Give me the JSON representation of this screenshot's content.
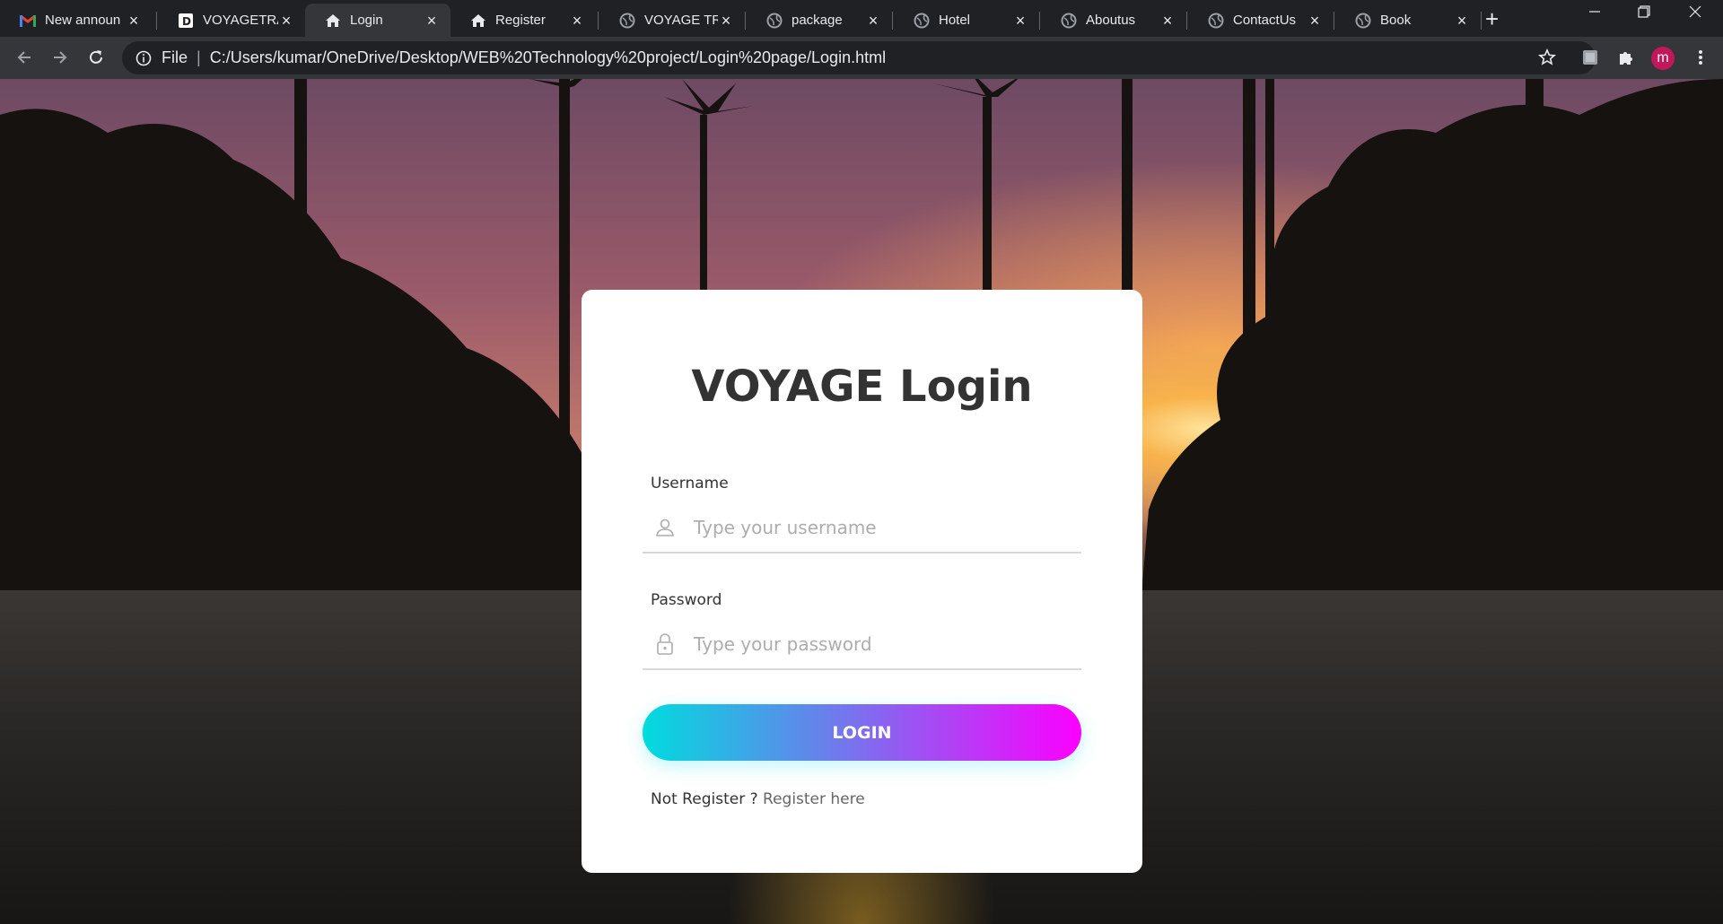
{
  "browser": {
    "tabs": [
      {
        "label": "New announ",
        "icon": "gmail-icon"
      },
      {
        "label": "VOYAGETRA",
        "icon": "page-d-icon"
      },
      {
        "label": "Login",
        "icon": "home-icon",
        "active": true
      },
      {
        "label": "Register",
        "icon": "home-icon"
      },
      {
        "label": "VOYAGE TRA",
        "icon": "globe-icon"
      },
      {
        "label": "package",
        "icon": "globe-icon"
      },
      {
        "label": "Hotel",
        "icon": "globe-icon"
      },
      {
        "label": "Aboutus",
        "icon": "globe-icon"
      },
      {
        "label": "ContactUs",
        "icon": "globe-icon"
      },
      {
        "label": "Book",
        "icon": "globe-icon"
      }
    ],
    "new_tab": "+",
    "address": {
      "scheme": "File",
      "divider": "|",
      "url": "C:/Users/kumar/OneDrive/Desktop/WEB%20Technology%20project/Login%20page/Login.html"
    },
    "profile_initial": "m"
  },
  "login": {
    "title": "VOYAGE Login",
    "username_label": "Username",
    "username_placeholder": "Type your username",
    "password_label": "Password",
    "password_placeholder": "Type your password",
    "button_label": "LOGIN",
    "register_prompt": "Not Register ?",
    "register_link": "Register here"
  },
  "colors": {
    "button_gradient_start": "#00dbde",
    "button_gradient_end": "#fc00ff",
    "card_background": "#ffffff",
    "title_color": "#333333"
  }
}
